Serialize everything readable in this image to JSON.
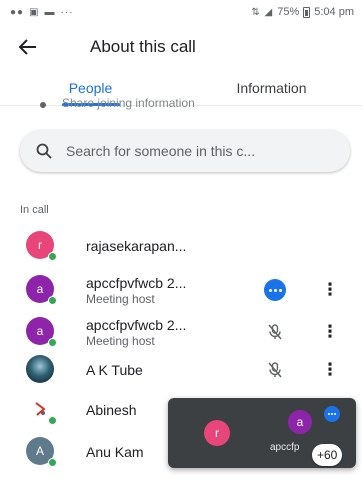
{
  "status_bar": {
    "left_icons": [
      "signal-icon",
      "image-icon",
      "video-icon"
    ],
    "right_text": "75% ",
    "time": "5:04 pm"
  },
  "app_bar": {
    "title": "About this call"
  },
  "tabs": [
    {
      "label": "People",
      "active": true
    },
    {
      "label": "Information",
      "active": false
    }
  ],
  "scrolled_row_text": "Share joining information",
  "search": {
    "placeholder": "Search for someone in this c..."
  },
  "section_label": "In call",
  "participants": [
    {
      "name": "rajasekarapan...",
      "subtitle": "",
      "initial": "r",
      "avatar_color": "#e8457a",
      "status_icon": "none"
    },
    {
      "name": "apccfpvfwcb 2...",
      "subtitle": "Meeting host",
      "initial": "a",
      "avatar_color": "#8e24aa",
      "status_icon": "speaking-icon"
    },
    {
      "name": "apccfpvfwcb 2...",
      "subtitle": "Meeting host",
      "initial": "a",
      "avatar_color": "#8e24aa",
      "status_icon": "mic-off-icon"
    },
    {
      "name": "A K Tube",
      "subtitle": "",
      "initial": "",
      "avatar_color": "#2f5f72",
      "status_icon": "mic-off-icon"
    },
    {
      "name": "Abinesh",
      "subtitle": "",
      "initial": "",
      "avatar_color": "#ffffff",
      "status_icon": "none"
    },
    {
      "name": "Anu Kam",
      "subtitle": "",
      "initial": "A",
      "avatar_color": "#5f7a8a",
      "status_icon": "none"
    }
  ],
  "pip": {
    "avatar_r": "r",
    "avatar_a": "a",
    "name": "apccfp",
    "count": "+60"
  },
  "colors": {
    "accent": "#1a73e8",
    "presence_green": "#34a853"
  }
}
